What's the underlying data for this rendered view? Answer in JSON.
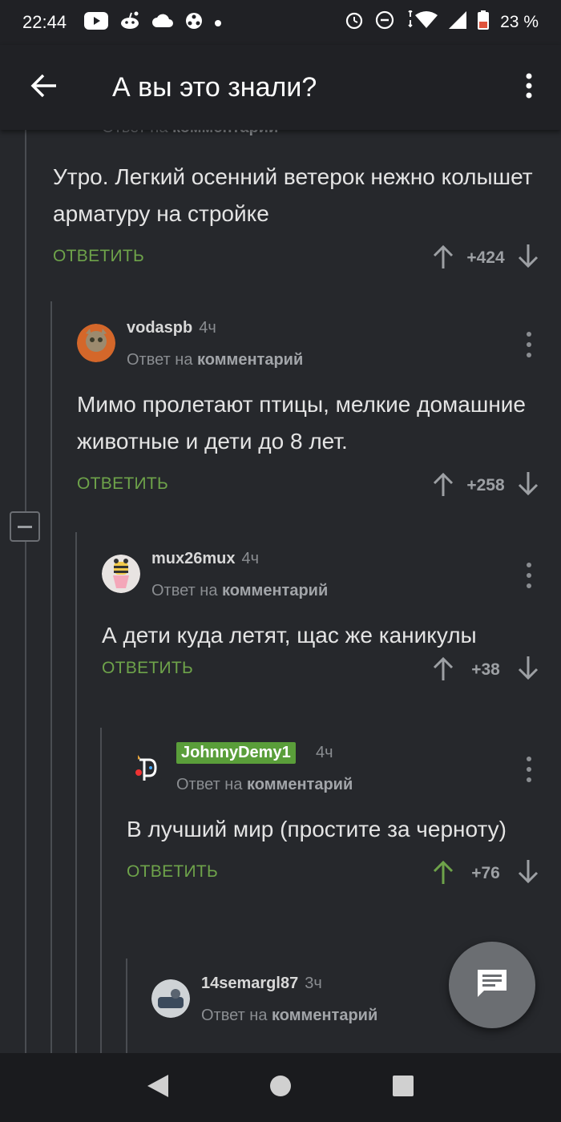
{
  "status": {
    "time": "22:44",
    "battery": "23 %",
    "icons": [
      "youtube-icon",
      "reddit-icon",
      "cloud-icon",
      "hub-icon",
      "dot-icon",
      "alarm-icon",
      "dnd-icon",
      "wifi-icon",
      "signal-icon",
      "battery-icon"
    ]
  },
  "appbar": {
    "title": "А вы это знали?",
    "back_icon": "arrow-back-icon",
    "menu_icon": "more-vert-icon"
  },
  "partial_header": {
    "reply_prefix": "Ответ на",
    "reply_target": "комментарий"
  },
  "comments": [
    {
      "author": "",
      "time": "",
      "reply_prefix": "Ответ на",
      "reply_target": "комментарий",
      "text": "Утро. Легкий осенний ветерок нежно колышет арматуру на стройке",
      "reply_label": "ОТВЕТИТЬ",
      "score": "+424",
      "upvoted": false
    },
    {
      "author": "vodaspb",
      "time": "4ч",
      "reply_prefix": "Ответ на",
      "reply_target": "комментарий",
      "text": "Мимо пролетают птицы, мелкие домашние животные и дети до 8 лет.",
      "reply_label": "ОТВЕТИТЬ",
      "score": "+258",
      "upvoted": false
    },
    {
      "author": "mux26mux",
      "time": "4ч",
      "reply_prefix": "Ответ на",
      "reply_target": "комментарий",
      "text": "А дети куда летят, щас же каникулы",
      "reply_label": "ОТВЕТИТЬ",
      "score": "+38",
      "upvoted": false
    },
    {
      "author": "JohnnyDemy1",
      "time": "4ч",
      "reply_prefix": "Ответ на",
      "reply_target": "комментарий",
      "text": "В лучший мир (простите за черноту)",
      "reply_label": "ОТВЕТИТЬ",
      "score": "+76",
      "upvoted": true,
      "author_badge": true
    },
    {
      "author": "14semargl87",
      "time": "3ч",
      "reply_prefix": "Ответ на",
      "reply_target": "комментарий"
    }
  ],
  "colors": {
    "background": "#26282c",
    "appbar": "#202125",
    "accent_green": "#6ea34a",
    "badge_green": "#5a9e3a",
    "muted": "#8a8d91"
  },
  "fab_icon": "comment-icon",
  "navbar": {
    "back_icon": "nav-back-icon",
    "home_icon": "nav-home-icon",
    "recents_icon": "nav-recents-icon"
  }
}
